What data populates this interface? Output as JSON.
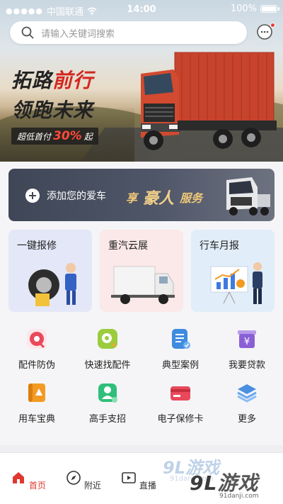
{
  "status_bar": {
    "dots": "●●●●●",
    "carrier": "中国联通",
    "time": "14:00",
    "battery": "100%"
  },
  "search": {
    "placeholder": "请输入关键词搜索"
  },
  "banner": {
    "line1_a": "拓路",
    "line1_b": "前行",
    "line2": "领跑未来",
    "promo_prefix": "超低首付",
    "promo_percent": "30%",
    "promo_suffix": "起"
  },
  "add_car": {
    "label": "添加您的爱车",
    "service_prefix": "享",
    "service_brand": "豪人",
    "service_suffix": "服务"
  },
  "cards": [
    {
      "title": "一键报修"
    },
    {
      "title": "重汽云展"
    },
    {
      "title": "行车月报"
    }
  ],
  "grid": [
    {
      "label": "配件防伪",
      "icon": "shield-parts-icon",
      "color": "#e9495a"
    },
    {
      "label": "快速找配件",
      "icon": "gear-search-icon",
      "color": "#9bcc3e"
    },
    {
      "label": "典型案例",
      "icon": "document-check-icon",
      "color": "#3e8bdf"
    },
    {
      "label": "我要贷款",
      "icon": "yen-box-icon",
      "color": "#8a5fd6"
    },
    {
      "label": "用车宝典",
      "icon": "book-icon",
      "color": "#f39a23"
    },
    {
      "label": "高手支招",
      "icon": "expert-user-icon",
      "color": "#2fbf7a"
    },
    {
      "label": "电子保修卡",
      "icon": "card-icon",
      "color": "#e9495a"
    },
    {
      "label": "更多",
      "icon": "layers-icon",
      "color": "#4a8fe0"
    }
  ],
  "tabbar": [
    {
      "label": "首页",
      "icon": "home-icon",
      "active": true
    },
    {
      "label": "附近",
      "icon": "compass-icon",
      "active": false
    },
    {
      "label": "直播",
      "icon": "live-tv-icon",
      "active": false
    }
  ],
  "watermark": {
    "logo_a": "9L",
    "logo_b": "游戏",
    "url": "91danji.com",
    "ghost": "9L游戏",
    "ghost_url": "91danji.com"
  },
  "colors": {
    "accent": "#e0382f",
    "banner_dark": "#3f4656"
  }
}
